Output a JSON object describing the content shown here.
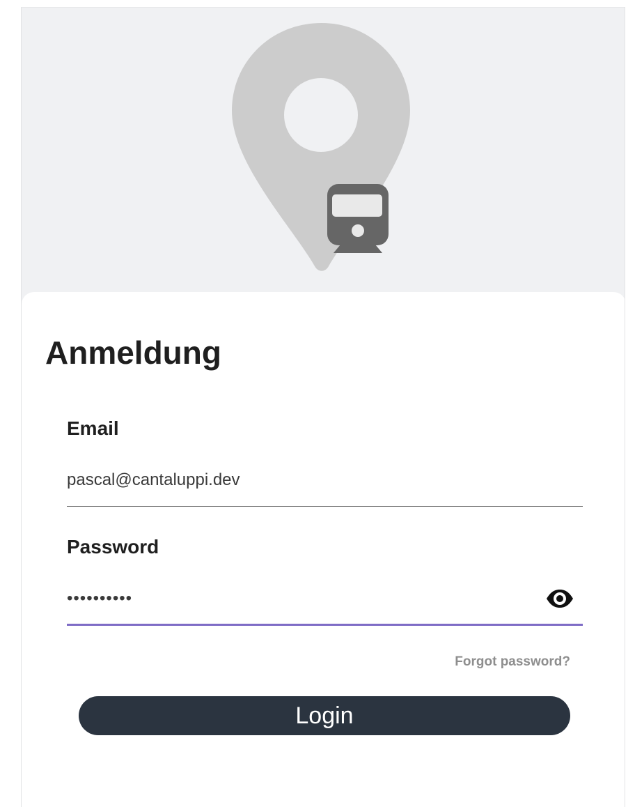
{
  "hero": {
    "icon": "map-pin-train-icon",
    "colors": {
      "background": "#f0f1f3",
      "pin": "#cccccc",
      "train": "#666666"
    }
  },
  "login": {
    "title": "Anmeldung",
    "email": {
      "label": "Email",
      "value": "pascal@cantaluppi.dev"
    },
    "password": {
      "label": "Password",
      "value": "••••••••••",
      "toggle_icon": "eye-icon"
    },
    "forgot_password": "Forgot password?",
    "submit_label": "Login"
  },
  "colors": {
    "accent_underline": "#7e6cc6",
    "button": "#2b3440",
    "link": "#8e8e8e"
  }
}
